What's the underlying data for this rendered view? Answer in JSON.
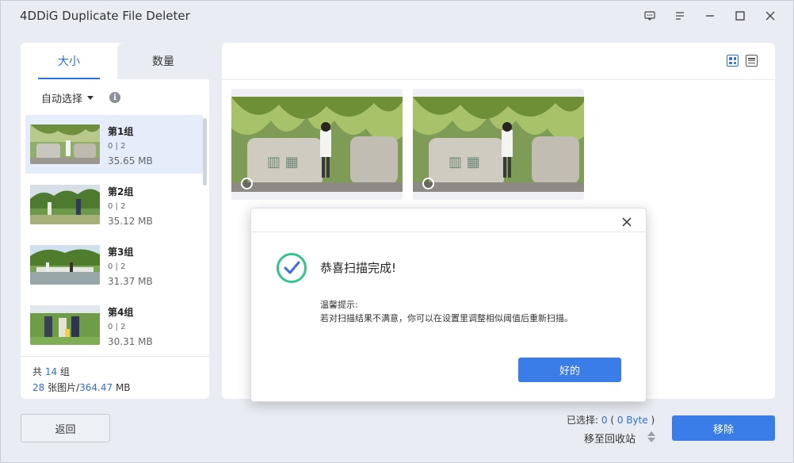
{
  "app": {
    "title": "4DDiG Duplicate File Deleter"
  },
  "titlebar": {
    "icons": [
      "feedback-icon",
      "menu-icon",
      "minimize-icon",
      "maximize-icon",
      "close-icon"
    ]
  },
  "left": {
    "tabs": [
      {
        "label": "大小",
        "active": true
      },
      {
        "label": "数量",
        "active": false
      }
    ],
    "auto_select": "自动选择",
    "groups": [
      {
        "name": "第1组",
        "count": "0 | 2",
        "size": "35.65 MB",
        "selected": true
      },
      {
        "name": "第2组",
        "count": "0 | 2",
        "size": "35.12 MB",
        "selected": false
      },
      {
        "name": "第3组",
        "count": "0 | 2",
        "size": "31.37 MB",
        "selected": false
      },
      {
        "name": "第4组",
        "count": "0 | 2",
        "size": "30.31 MB",
        "selected": false
      }
    ],
    "footer": {
      "total_prefix": "共 ",
      "total_groups": "14",
      "total_suffix": " 组",
      "photos": "28",
      "photos_label": " 张图片/",
      "size": "364.47",
      "size_unit": " MB"
    }
  },
  "dialog": {
    "title": "恭喜扫描完成!",
    "tip_title": "温馨提示:",
    "tip_body": "若对扫描结果不满意，你可以在设置里调整相似阈值后重新扫描。",
    "ok": "好的"
  },
  "bottom": {
    "back": "返回",
    "selected_label": "已选择: ",
    "selected_count": "0",
    "selected_size": "0 Byte",
    "recycle": "移至回收站",
    "remove": "移除"
  },
  "colors": {
    "accent": "#2c6fe0",
    "button": "#3b7de8",
    "check": "#2fc58a"
  }
}
